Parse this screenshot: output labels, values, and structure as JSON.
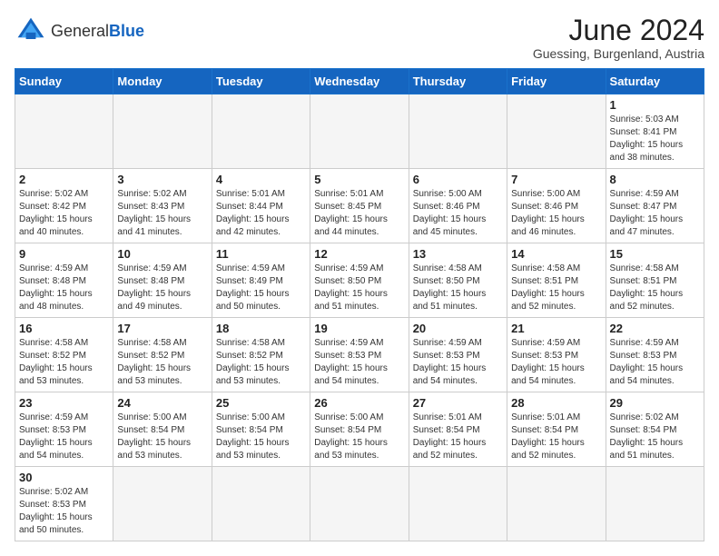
{
  "header": {
    "logo_general": "General",
    "logo_blue": "Blue",
    "month_year": "June 2024",
    "location": "Guessing, Burgenland, Austria"
  },
  "weekdays": [
    "Sunday",
    "Monday",
    "Tuesday",
    "Wednesday",
    "Thursday",
    "Friday",
    "Saturday"
  ],
  "weeks": [
    [
      {
        "day": "",
        "info": ""
      },
      {
        "day": "",
        "info": ""
      },
      {
        "day": "",
        "info": ""
      },
      {
        "day": "",
        "info": ""
      },
      {
        "day": "",
        "info": ""
      },
      {
        "day": "",
        "info": ""
      },
      {
        "day": "1",
        "info": "Sunrise: 5:03 AM\nSunset: 8:41 PM\nDaylight: 15 hours\nand 38 minutes."
      }
    ],
    [
      {
        "day": "2",
        "info": "Sunrise: 5:02 AM\nSunset: 8:42 PM\nDaylight: 15 hours\nand 40 minutes."
      },
      {
        "day": "3",
        "info": "Sunrise: 5:02 AM\nSunset: 8:43 PM\nDaylight: 15 hours\nand 41 minutes."
      },
      {
        "day": "4",
        "info": "Sunrise: 5:01 AM\nSunset: 8:44 PM\nDaylight: 15 hours\nand 42 minutes."
      },
      {
        "day": "5",
        "info": "Sunrise: 5:01 AM\nSunset: 8:45 PM\nDaylight: 15 hours\nand 44 minutes."
      },
      {
        "day": "6",
        "info": "Sunrise: 5:00 AM\nSunset: 8:46 PM\nDaylight: 15 hours\nand 45 minutes."
      },
      {
        "day": "7",
        "info": "Sunrise: 5:00 AM\nSunset: 8:46 PM\nDaylight: 15 hours\nand 46 minutes."
      },
      {
        "day": "8",
        "info": "Sunrise: 4:59 AM\nSunset: 8:47 PM\nDaylight: 15 hours\nand 47 minutes."
      }
    ],
    [
      {
        "day": "9",
        "info": "Sunrise: 4:59 AM\nSunset: 8:48 PM\nDaylight: 15 hours\nand 48 minutes."
      },
      {
        "day": "10",
        "info": "Sunrise: 4:59 AM\nSunset: 8:48 PM\nDaylight: 15 hours\nand 49 minutes."
      },
      {
        "day": "11",
        "info": "Sunrise: 4:59 AM\nSunset: 8:49 PM\nDaylight: 15 hours\nand 50 minutes."
      },
      {
        "day": "12",
        "info": "Sunrise: 4:59 AM\nSunset: 8:50 PM\nDaylight: 15 hours\nand 51 minutes."
      },
      {
        "day": "13",
        "info": "Sunrise: 4:58 AM\nSunset: 8:50 PM\nDaylight: 15 hours\nand 51 minutes."
      },
      {
        "day": "14",
        "info": "Sunrise: 4:58 AM\nSunset: 8:51 PM\nDaylight: 15 hours\nand 52 minutes."
      },
      {
        "day": "15",
        "info": "Sunrise: 4:58 AM\nSunset: 8:51 PM\nDaylight: 15 hours\nand 52 minutes."
      }
    ],
    [
      {
        "day": "16",
        "info": "Sunrise: 4:58 AM\nSunset: 8:52 PM\nDaylight: 15 hours\nand 53 minutes."
      },
      {
        "day": "17",
        "info": "Sunrise: 4:58 AM\nSunset: 8:52 PM\nDaylight: 15 hours\nand 53 minutes."
      },
      {
        "day": "18",
        "info": "Sunrise: 4:58 AM\nSunset: 8:52 PM\nDaylight: 15 hours\nand 53 minutes."
      },
      {
        "day": "19",
        "info": "Sunrise: 4:59 AM\nSunset: 8:53 PM\nDaylight: 15 hours\nand 54 minutes."
      },
      {
        "day": "20",
        "info": "Sunrise: 4:59 AM\nSunset: 8:53 PM\nDaylight: 15 hours\nand 54 minutes."
      },
      {
        "day": "21",
        "info": "Sunrise: 4:59 AM\nSunset: 8:53 PM\nDaylight: 15 hours\nand 54 minutes."
      },
      {
        "day": "22",
        "info": "Sunrise: 4:59 AM\nSunset: 8:53 PM\nDaylight: 15 hours\nand 54 minutes."
      }
    ],
    [
      {
        "day": "23",
        "info": "Sunrise: 4:59 AM\nSunset: 8:53 PM\nDaylight: 15 hours\nand 54 minutes."
      },
      {
        "day": "24",
        "info": "Sunrise: 5:00 AM\nSunset: 8:54 PM\nDaylight: 15 hours\nand 53 minutes."
      },
      {
        "day": "25",
        "info": "Sunrise: 5:00 AM\nSunset: 8:54 PM\nDaylight: 15 hours\nand 53 minutes."
      },
      {
        "day": "26",
        "info": "Sunrise: 5:00 AM\nSunset: 8:54 PM\nDaylight: 15 hours\nand 53 minutes."
      },
      {
        "day": "27",
        "info": "Sunrise: 5:01 AM\nSunset: 8:54 PM\nDaylight: 15 hours\nand 52 minutes."
      },
      {
        "day": "28",
        "info": "Sunrise: 5:01 AM\nSunset: 8:54 PM\nDaylight: 15 hours\nand 52 minutes."
      },
      {
        "day": "29",
        "info": "Sunrise: 5:02 AM\nSunset: 8:54 PM\nDaylight: 15 hours\nand 51 minutes."
      }
    ],
    [
      {
        "day": "30",
        "info": "Sunrise: 5:02 AM\nSunset: 8:53 PM\nDaylight: 15 hours\nand 50 minutes."
      },
      {
        "day": "",
        "info": ""
      },
      {
        "day": "",
        "info": ""
      },
      {
        "day": "",
        "info": ""
      },
      {
        "day": "",
        "info": ""
      },
      {
        "day": "",
        "info": ""
      },
      {
        "day": "",
        "info": ""
      }
    ]
  ]
}
